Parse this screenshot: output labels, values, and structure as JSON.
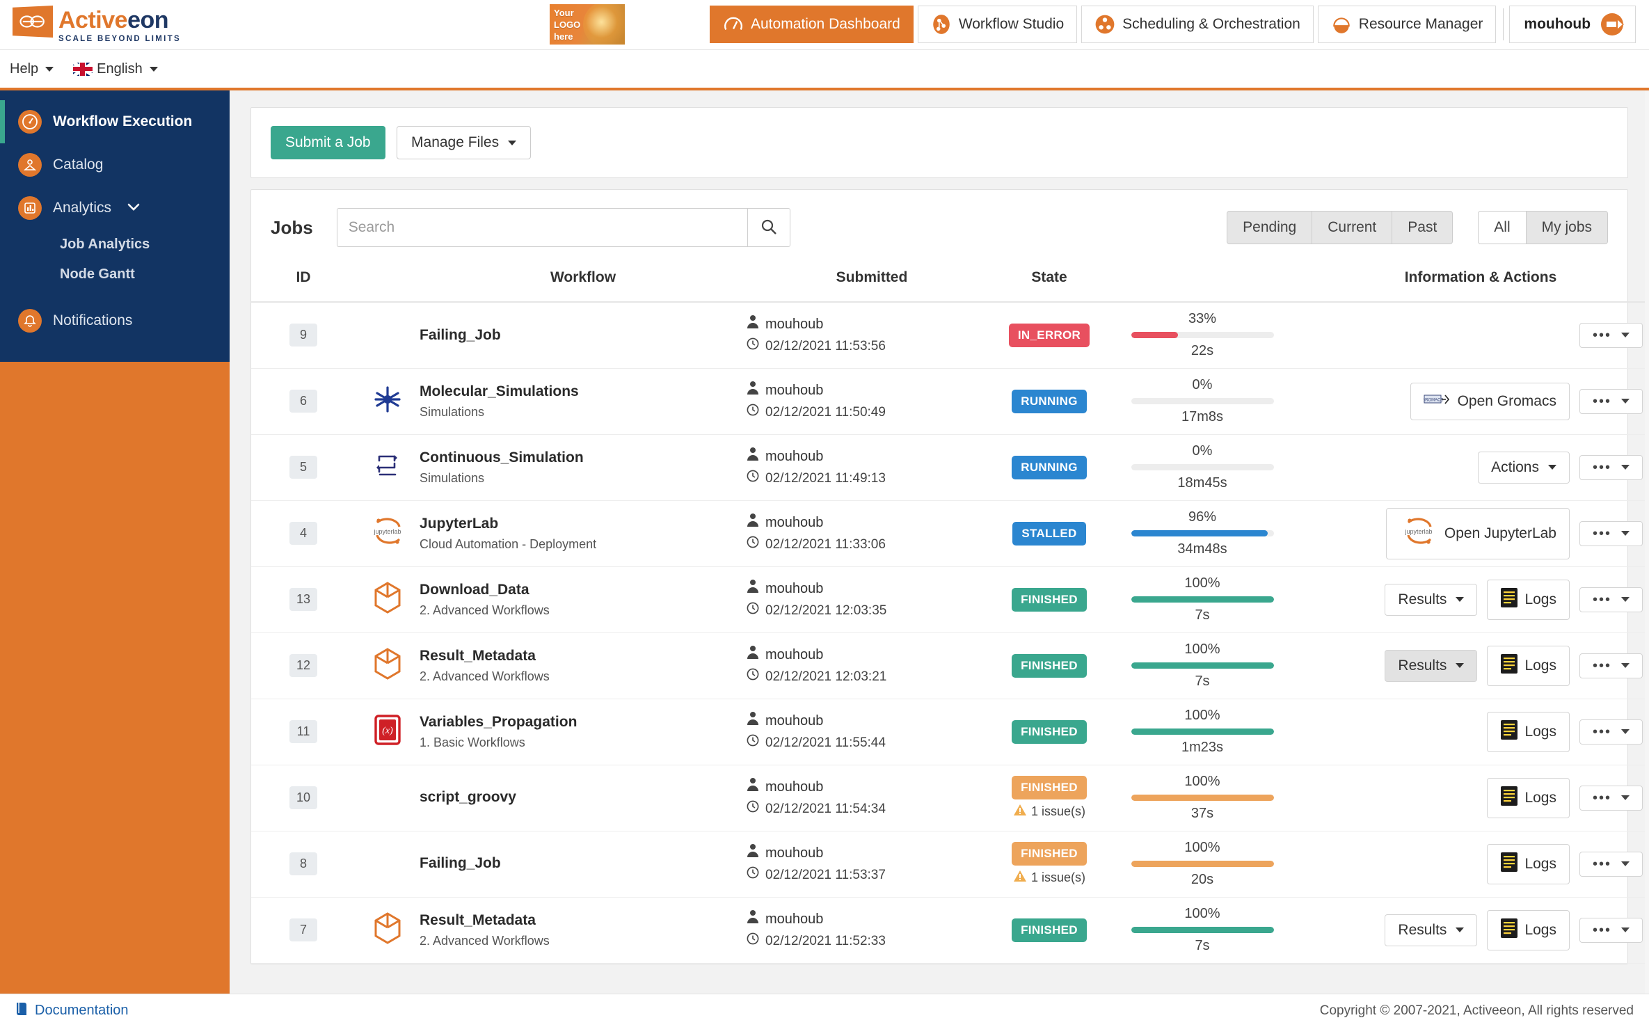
{
  "brand": {
    "name_orange": "Active",
    "name_dark": "eon",
    "tagline": "SCALE BEYOND LIMITS"
  },
  "logo_banner": {
    "line1": "Your",
    "line2": "LOGO",
    "line3": "here"
  },
  "topnav": {
    "tabs": [
      {
        "label": "Automation Dashboard",
        "icon": "speedometer-icon",
        "active": true
      },
      {
        "label": "Workflow Studio",
        "icon": "workflow-studio-icon",
        "active": false
      },
      {
        "label": "Scheduling & Orchestration",
        "icon": "scheduling-icon",
        "active": false
      },
      {
        "label": "Resource Manager",
        "icon": "resource-manager-icon",
        "active": false
      }
    ],
    "user": "mouhoub"
  },
  "subbar": {
    "help": "Help",
    "language": "English"
  },
  "sidebar": {
    "items": [
      {
        "label": "Workflow Execution",
        "icon": "speedometer-icon",
        "active": true,
        "sub": []
      },
      {
        "label": "Catalog",
        "icon": "catalog-icon",
        "active": false,
        "sub": []
      },
      {
        "label": "Analytics",
        "icon": "analytics-icon",
        "active": false,
        "expandable": true,
        "sub": [
          "Job Analytics",
          "Node Gantt"
        ]
      },
      {
        "label": "Notifications",
        "icon": "notifications-icon",
        "active": false,
        "sub": []
      }
    ]
  },
  "toolbar": {
    "submit_label": "Submit a Job",
    "manage_files_label": "Manage Files"
  },
  "jobs_panel": {
    "title": "Jobs",
    "search_placeholder": "Search",
    "search_value": "",
    "status_filters": [
      {
        "label": "Pending",
        "selected": true
      },
      {
        "label": "Current",
        "selected": true
      },
      {
        "label": "Past",
        "selected": true
      }
    ],
    "owner_filters": [
      {
        "label": "All",
        "selected": false
      },
      {
        "label": "My jobs",
        "selected": true
      }
    ],
    "columns": [
      "ID",
      "Workflow",
      "Submitted",
      "State",
      "Information & Actions"
    ]
  },
  "colors": {
    "brand_orange": "#e0772c",
    "sidebar_navy": "#123463",
    "accent_green": "#3aa78e",
    "state_error": "#e8505f",
    "state_running": "#2b86d0",
    "state_stalled": "#2b86d0",
    "state_finished": "#3aa78e",
    "state_finished_issues": "#edа35a",
    "state_finished_issues_hex": "#eda45c"
  },
  "rows": [
    {
      "id": "9",
      "icon": "",
      "workflow": "Failing_Job",
      "project": "",
      "user": "mouhoub",
      "submitted": "02/12/2021 11:53:56",
      "state": "IN_ERROR",
      "state_color": "#e8505f",
      "issues": "",
      "percent": "33%",
      "percent_value": 33,
      "bar_color": "#e8505f",
      "duration": "22s",
      "actions": []
    },
    {
      "id": "6",
      "icon": "molecular-icon",
      "workflow": "Molecular_Simulations",
      "project": "Simulations",
      "user": "mouhoub",
      "submitted": "02/12/2021 11:50:49",
      "state": "RUNNING",
      "state_color": "#2b86d0",
      "issues": "",
      "percent": "0%",
      "percent_value": 0,
      "bar_color": "#2b86d0",
      "duration": "17m8s",
      "actions": [
        {
          "label": "Open Gromacs",
          "icon": "gromacs-icon",
          "type": "link"
        }
      ]
    },
    {
      "id": "5",
      "icon": "continuous-simulation-icon",
      "workflow": "Continuous_Simulation",
      "project": "Simulations",
      "user": "mouhoub",
      "submitted": "02/12/2021 11:49:13",
      "state": "RUNNING",
      "state_color": "#2b86d0",
      "issues": "",
      "percent": "0%",
      "percent_value": 0,
      "bar_color": "#2b86d0",
      "duration": "18m45s",
      "actions": [
        {
          "label": "Actions",
          "icon": "",
          "type": "dropdown"
        }
      ]
    },
    {
      "id": "4",
      "icon": "jupyterlab-icon",
      "workflow": "JupyterLab",
      "project": "Cloud Automation - Deployment",
      "user": "mouhoub",
      "submitted": "02/12/2021 11:33:06",
      "state": "STALLED",
      "state_color": "#2b86d0",
      "issues": "",
      "percent": "96%",
      "percent_value": 96,
      "bar_color": "#2b86d0",
      "duration": "34m48s",
      "actions": [
        {
          "label": "Open JupyterLab",
          "icon": "jupyterlab-icon",
          "type": "link"
        }
      ]
    },
    {
      "id": "13",
      "icon": "package-icon",
      "workflow": "Download_Data",
      "project": "2. Advanced Workflows",
      "user": "mouhoub",
      "submitted": "02/12/2021 12:03:35",
      "state": "FINISHED",
      "state_color": "#3aa78e",
      "issues": "",
      "percent": "100%",
      "percent_value": 100,
      "bar_color": "#3aa78e",
      "duration": "7s",
      "actions": [
        {
          "label": "Results",
          "icon": "",
          "type": "dropdown"
        },
        {
          "label": "Logs",
          "icon": "logs-icon",
          "type": "button"
        }
      ]
    },
    {
      "id": "12",
      "icon": "package-icon",
      "workflow": "Result_Metadata",
      "project": "2. Advanced Workflows",
      "user": "mouhoub",
      "submitted": "02/12/2021 12:03:21",
      "state": "FINISHED",
      "state_color": "#3aa78e",
      "issues": "",
      "percent": "100%",
      "percent_value": 100,
      "bar_color": "#3aa78e",
      "duration": "7s",
      "actions": [
        {
          "label": "Results",
          "icon": "",
          "type": "dropdown",
          "pressed": true
        },
        {
          "label": "Logs",
          "icon": "logs-icon",
          "type": "button"
        }
      ]
    },
    {
      "id": "11",
      "icon": "variables-icon",
      "workflow": "Variables_Propagation",
      "project": "1. Basic Workflows",
      "user": "mouhoub",
      "submitted": "02/12/2021 11:55:44",
      "state": "FINISHED",
      "state_color": "#3aa78e",
      "issues": "",
      "percent": "100%",
      "percent_value": 100,
      "bar_color": "#3aa78e",
      "duration": "1m23s",
      "actions": [
        {
          "label": "Logs",
          "icon": "logs-icon",
          "type": "button"
        }
      ]
    },
    {
      "id": "10",
      "icon": "",
      "workflow": "script_groovy",
      "project": "",
      "user": "mouhoub",
      "submitted": "02/12/2021 11:54:34",
      "state": "FINISHED",
      "state_color": "#eda45c",
      "issues": "1 issue(s)",
      "percent": "100%",
      "percent_value": 100,
      "bar_color": "#eda45c",
      "duration": "37s",
      "actions": [
        {
          "label": "Logs",
          "icon": "logs-icon",
          "type": "button"
        }
      ]
    },
    {
      "id": "8",
      "icon": "",
      "workflow": "Failing_Job",
      "project": "",
      "user": "mouhoub",
      "submitted": "02/12/2021 11:53:37",
      "state": "FINISHED",
      "state_color": "#eda45c",
      "issues": "1 issue(s)",
      "percent": "100%",
      "percent_value": 100,
      "bar_color": "#eda45c",
      "duration": "20s",
      "actions": [
        {
          "label": "Logs",
          "icon": "logs-icon",
          "type": "button"
        }
      ]
    },
    {
      "id": "7",
      "icon": "package-icon",
      "workflow": "Result_Metadata",
      "project": "2. Advanced Workflows",
      "user": "mouhoub",
      "submitted": "02/12/2021 11:52:33",
      "state": "FINISHED",
      "state_color": "#3aa78e",
      "issues": "",
      "percent": "100%",
      "percent_value": 100,
      "bar_color": "#3aa78e",
      "duration": "7s",
      "actions": [
        {
          "label": "Results",
          "icon": "",
          "type": "dropdown"
        },
        {
          "label": "Logs",
          "icon": "logs-icon",
          "type": "button"
        }
      ]
    }
  ],
  "footer": {
    "documentation": "Documentation",
    "copyright": "Copyright © 2007-2021, Activeeon, All rights reserved"
  }
}
